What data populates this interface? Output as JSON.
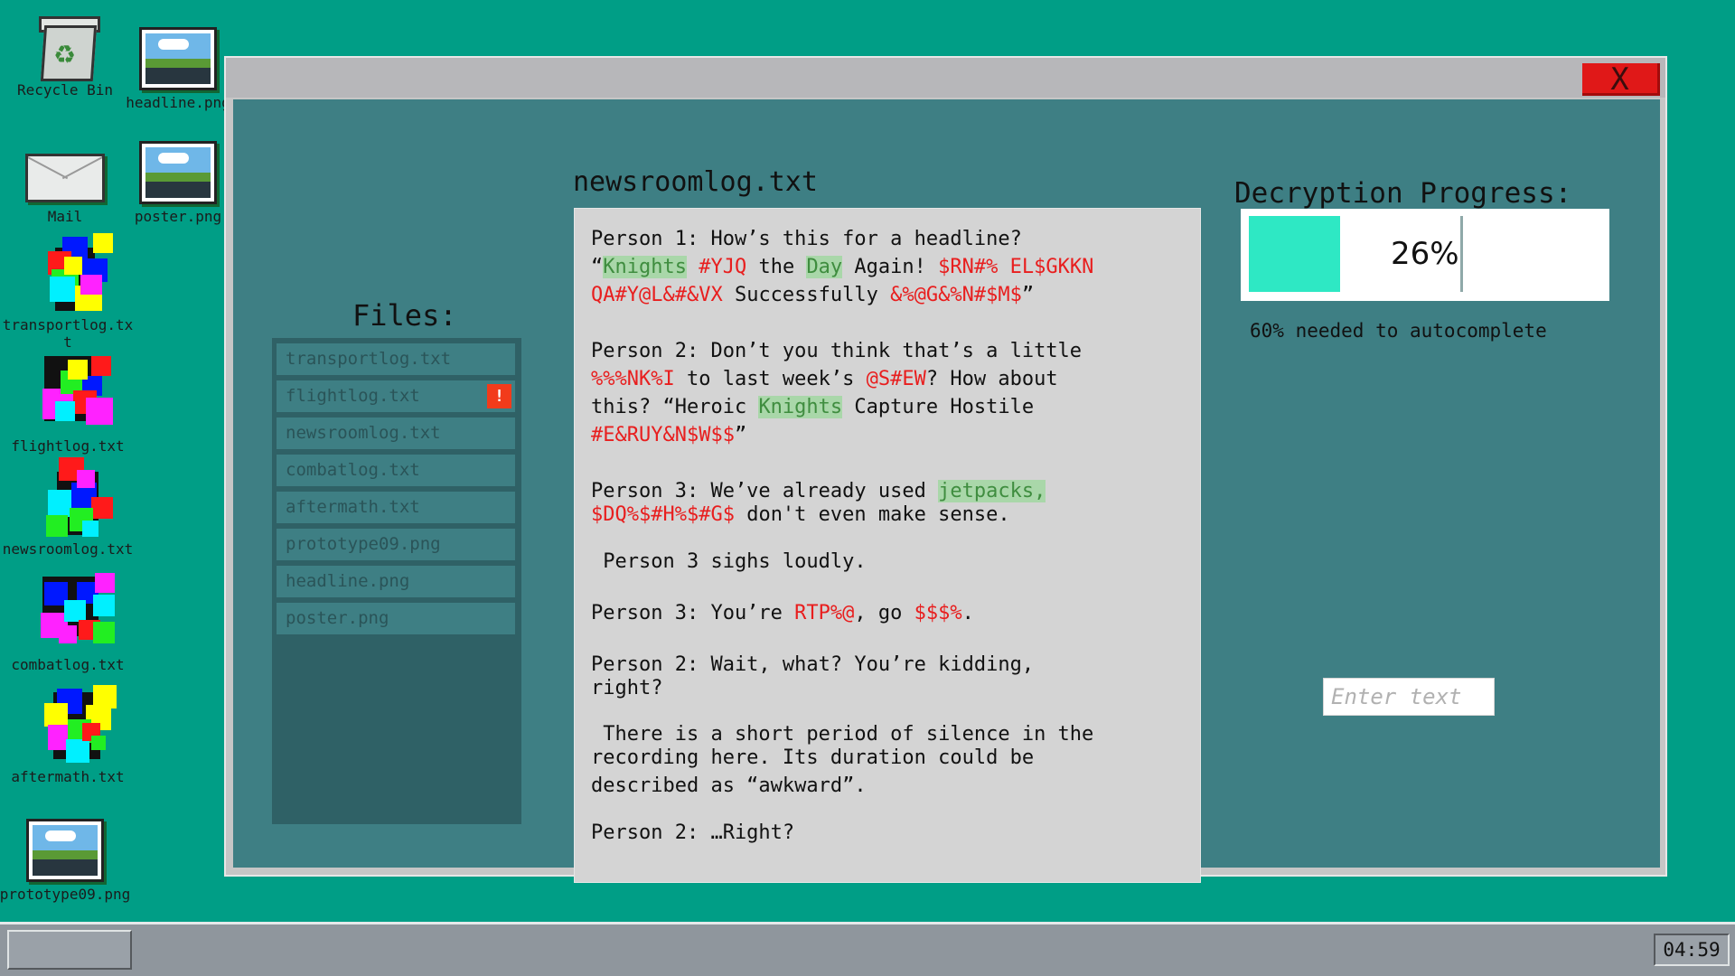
{
  "desktop": {
    "icons": [
      {
        "label": "Recycle Bin",
        "icon": "recycle-bin-icon"
      },
      {
        "label": "headline.png",
        "icon": "image-file-icon"
      },
      {
        "label": "Mail",
        "icon": "mail-icon"
      },
      {
        "label": "poster.png",
        "icon": "image-file-icon"
      },
      {
        "label": "transportlog.txt",
        "icon": "corrupted-file-icon"
      },
      {
        "label": "flightlog.txt",
        "icon": "corrupted-file-icon"
      },
      {
        "label": "newsroomlog.txt",
        "icon": "corrupted-file-icon"
      },
      {
        "label": "combatlog.txt",
        "icon": "corrupted-file-icon"
      },
      {
        "label": "aftermath.txt",
        "icon": "corrupted-file-icon"
      },
      {
        "label": "prototype09.png",
        "icon": "image-file-icon"
      }
    ]
  },
  "window": {
    "close_label": "X",
    "files_title": "Files:",
    "files": [
      {
        "name": "transportlog.txt",
        "alert": ""
      },
      {
        "name": "flightlog.txt",
        "alert": "!"
      },
      {
        "name": "newsroomlog.txt",
        "alert": ""
      },
      {
        "name": "combatlog.txt",
        "alert": ""
      },
      {
        "name": "aftermath.txt",
        "alert": ""
      },
      {
        "name": "prototype09.png",
        "alert": ""
      },
      {
        "name": "headline.png",
        "alert": ""
      },
      {
        "name": "poster.png",
        "alert": ""
      }
    ],
    "document": {
      "title": "newsroomlog.txt",
      "lines": [
        [
          {
            "t": "Person 1: How’s this for a headline?",
            "s": "n"
          }
        ],
        [
          {
            "t": "“",
            "s": "n"
          },
          {
            "t": "Knights",
            "s": "hl"
          },
          {
            "t": " ",
            "s": "n"
          },
          {
            "t": "#YJQ",
            "s": "r"
          },
          {
            "t": " the ",
            "s": "n"
          },
          {
            "t": "Day",
            "s": "hl"
          },
          {
            "t": " Again! ",
            "s": "n"
          },
          {
            "t": "$RN#% EL$GKKN",
            "s": "r"
          }
        ],
        [
          {
            "t": "QA#Y@L&#&VX",
            "s": "r"
          },
          {
            "t": " Successfully ",
            "s": "n"
          },
          {
            "t": "&%@G&%N#$M$",
            "s": "r"
          },
          {
            "t": "”",
            "s": "n"
          }
        ],
        [
          {
            "t": "Person 2: Don’t you think that’s a little",
            "s": "n"
          }
        ],
        [
          {
            "t": "%%%NK%I",
            "s": "r"
          },
          {
            "t": " to last week’s ",
            "s": "n"
          },
          {
            "t": "@S#EW",
            "s": "r"
          },
          {
            "t": "? How about",
            "s": "n"
          }
        ],
        [
          {
            "t": "this? “Heroic ",
            "s": "n"
          },
          {
            "t": "Knights",
            "s": "hl"
          },
          {
            "t": " Capture Hostile",
            "s": "n"
          }
        ],
        [
          {
            "t": "#E&RUY&N$W$$",
            "s": "r"
          },
          {
            "t": "”",
            "s": "n"
          }
        ],
        [
          {
            "t": "Person 3: We’ve already used ",
            "s": "n"
          },
          {
            "t": "jetpacks,",
            "s": "hl"
          }
        ],
        [
          {
            "t": "$DQ%$#H%$#G$",
            "s": "r"
          },
          {
            "t": " don't even make sense.",
            "s": "n"
          }
        ],
        [
          {
            "t": " Person 3 sighs loudly.",
            "s": "n"
          }
        ],
        [
          {
            "t": "Person 3: You’re ",
            "s": "n"
          },
          {
            "t": "RTP%@",
            "s": "r"
          },
          {
            "t": ", go ",
            "s": "n"
          },
          {
            "t": "$$$%",
            "s": "r"
          },
          {
            "t": ".",
            "s": "n"
          }
        ],
        [
          {
            "t": "Person 2: Wait, what? You’re kidding,",
            "s": "n"
          }
        ],
        [
          {
            "t": "right?",
            "s": "n"
          }
        ],
        [
          {
            "t": " There is a short period of silence in the",
            "s": "n"
          }
        ],
        [
          {
            "t": "recording here. Its duration could be",
            "s": "n"
          }
        ],
        [
          {
            "t": "described as “awkward”.",
            "s": "n"
          }
        ],
        [
          {
            "t": "Person 2: …Right?",
            "s": "n"
          }
        ]
      ]
    },
    "decryption": {
      "title": "Decryption Progress:",
      "percent_label": "26%",
      "progress": 0.26,
      "note": "60% needed to autocomplete",
      "input_placeholder": "Enter text",
      "input_value": ""
    }
  },
  "taskbar": {
    "clock": "04:59"
  },
  "colors": {
    "desktop": "#009e86",
    "window_body": "#3e7f84",
    "progress_fill": "#2ee8c4",
    "redacted": "#e81e1e",
    "highlight_bg": "#a9d7a9",
    "alert": "#f23b1b",
    "close": "#e01818"
  }
}
